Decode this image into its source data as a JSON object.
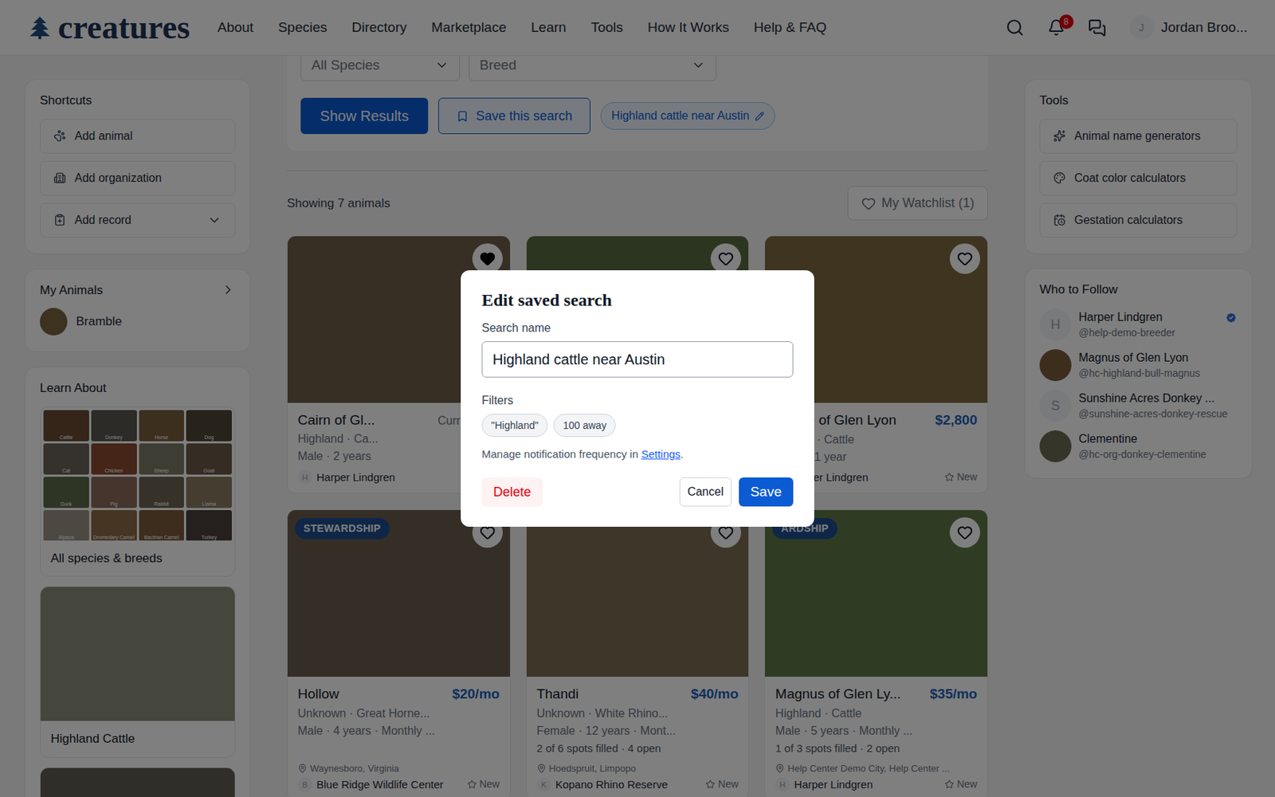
{
  "header": {
    "logo": "creatures",
    "nav": [
      "About",
      "Species",
      "Directory",
      "Marketplace",
      "Learn",
      "Tools",
      "How It Works",
      "Help & FAQ"
    ],
    "notifications": "8",
    "user": {
      "initial": "J",
      "name": "Jordan Broo..."
    }
  },
  "shortcuts": {
    "title": "Shortcuts",
    "items": [
      {
        "label": "Add animal",
        "expandable": false
      },
      {
        "label": "Add organization",
        "expandable": false
      },
      {
        "label": "Add record",
        "expandable": true
      }
    ]
  },
  "my_animals": {
    "title": "My Animals",
    "items": [
      "Bramble"
    ]
  },
  "learn_about": {
    "title": "Learn About",
    "species": [
      "Cattle",
      "Donkey",
      "Horse",
      "Dog",
      "Cat",
      "Chicken",
      "Sheep",
      "Goat",
      "Duck",
      "Pig",
      "Rabbit",
      "Llama",
      "Alpaca",
      "Dromedary Camel",
      "Bactrian Camel",
      "Turkey"
    ],
    "link": "All species & breeds",
    "featured": [
      "Highland Cattle"
    ]
  },
  "filters": {
    "species": "All Species",
    "breed": "Breed",
    "show_results": "Show Results",
    "save_search": "Save this search",
    "saved_chip": "Highland cattle near Austin"
  },
  "results": {
    "count": "Showing 7 animals",
    "watchlist": "My Watchlist (1)"
  },
  "cards": [
    {
      "title": "Cairn of Gl...",
      "price": null,
      "bid_label": "Current Bid:",
      "subtitle": "Highland · Ca...",
      "meta": "Male · 2 years",
      "spots": null,
      "location": null,
      "owner": "Harper Lindgren",
      "owner_initial": "H",
      "new": null,
      "badge": null,
      "favorited": true,
      "offset": false
    },
    {
      "title": null,
      "price": null,
      "bid_label": null,
      "subtitle": null,
      "meta": null,
      "spots": null,
      "location": null,
      "owner": null,
      "owner_initial": null,
      "new": null,
      "badge": null,
      "favorited": false,
      "offset": false
    },
    {
      "title": "e of Glen Lyon",
      "price": "$2,800",
      "bid_label": null,
      "subtitle": "d · Cattle",
      "meta": "· 1 year",
      "spots": null,
      "location": null,
      "owner": "per Lindgren",
      "owner_initial": null,
      "new": "New",
      "badge": null,
      "favorited": false,
      "offset": true
    },
    {
      "title": "Hollow",
      "price": "$20/mo",
      "bid_label": null,
      "subtitle": "Unknown · Great Horne...",
      "meta": "Male · 4 years · Monthly ...",
      "spots": null,
      "location": "Waynesboro, Virginia",
      "owner": "Blue Ridge Wildlife Center",
      "owner_initial": "B",
      "new": "New",
      "badge": "STEWARDSHIP",
      "favorited": false,
      "offset": false
    },
    {
      "title": "Thandi",
      "price": "$40/mo",
      "bid_label": null,
      "subtitle": "Unknown · White Rhino...",
      "meta": "Female · 12 years · Mont...",
      "spots": "2 of 6 spots filled · 4 open",
      "location": "Hoedspruit, Limpopo",
      "owner": "Kopano Rhino Reserve",
      "owner_initial": "K",
      "new": "New",
      "badge": null,
      "favorited": false,
      "offset": false
    },
    {
      "title": "Magnus of Glen Ly...",
      "price": "$35/mo",
      "bid_label": null,
      "subtitle": "Highland · Cattle",
      "meta": "Male · 5 years · Monthly ...",
      "spots": "1 of 3 spots filled · 2 open",
      "location": "Help Center Demo City, Help Center ...",
      "owner": "Harper Lindgren",
      "owner_initial": "H",
      "new": "New",
      "badge": "ARDSHIP",
      "favorited": false,
      "offset": false
    }
  ],
  "tools": {
    "title": "Tools",
    "items": [
      "Animal name generators",
      "Coat color calculators",
      "Gestation calculators"
    ]
  },
  "who_to_follow": {
    "title": "Who to Follow",
    "items": [
      {
        "name": "Harper Lindgren",
        "handle": "@help-demo-breeder",
        "initial": "H",
        "verified": true
      },
      {
        "name": "Magnus of Glen Lyon",
        "handle": "@hc-highland-bull-magnus",
        "initial": null,
        "verified": false
      },
      {
        "name": "Sunshine Acres Donkey ...",
        "handle": "@sunshine-acres-donkey-rescue",
        "initial": "S",
        "verified": false
      },
      {
        "name": "Clementine",
        "handle": "@hc-org-donkey-clementine",
        "initial": null,
        "verified": false
      }
    ]
  },
  "dialog": {
    "title": "Edit saved search",
    "name_label": "Search name",
    "name_value": "Highland cattle near Austin",
    "filters_label": "Filters",
    "filters": [
      "\"Highland\"",
      "100 away"
    ],
    "note": "Manage notification frequency in ",
    "note_link": "Settings",
    "note_end": ".",
    "delete": "Delete",
    "cancel": "Cancel",
    "save": "Save"
  }
}
